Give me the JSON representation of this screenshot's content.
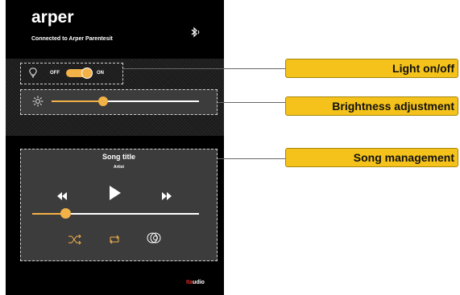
{
  "app": {
    "title": "arper",
    "connection_status": "Connected to Arper Parentesit",
    "brand_prefix": "Ita",
    "brand_suffix": "udio"
  },
  "light": {
    "off_label": "OFF",
    "on_label": "ON",
    "state": "on"
  },
  "brightness": {
    "level": 0.35
  },
  "song": {
    "title": "Song title",
    "artist": "Artist",
    "progress": 0.2
  },
  "callouts": [
    {
      "label": "Light on/off"
    },
    {
      "label": "Brightness adjustment"
    },
    {
      "label": "Song management"
    }
  ],
  "colors": {
    "accent": "#f3b248",
    "callout": "#f4c21a",
    "panel": "#3c3c3c",
    "background": "#000000"
  },
  "icons": [
    "bluetooth-icon",
    "bulb-icon",
    "sun-icon",
    "rewind-icon",
    "play-icon",
    "fast-forward-icon",
    "shuffle-icon",
    "repeat-icon",
    "speaker-icon"
  ]
}
